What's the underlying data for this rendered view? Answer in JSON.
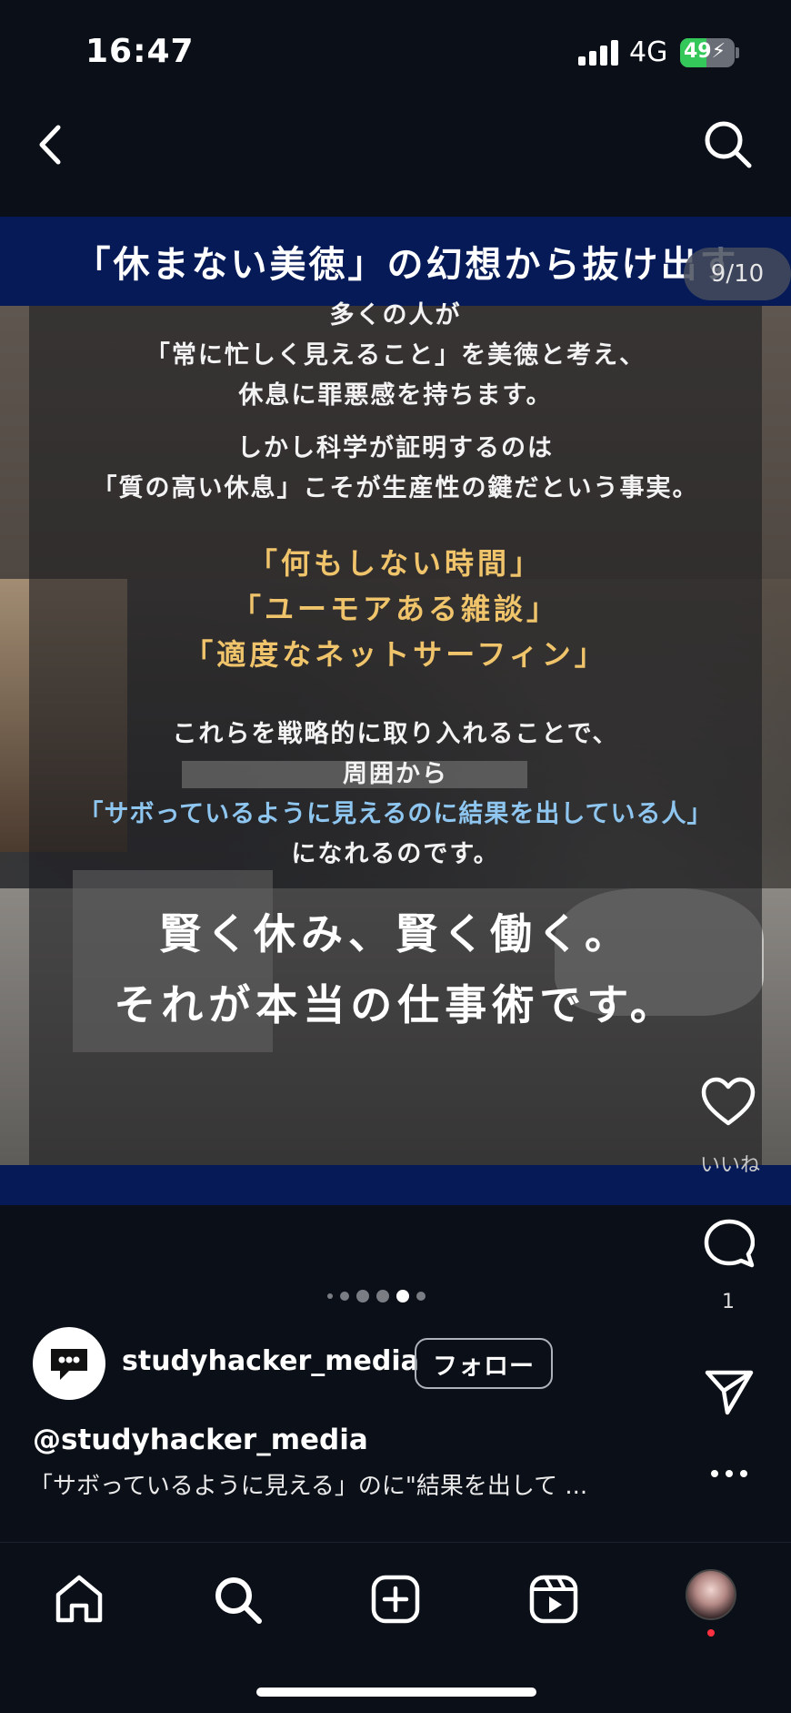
{
  "status_bar": {
    "time": "16:47",
    "network": "4G",
    "battery_text": "49",
    "battery_level": 0.49,
    "icons": [
      "signal-icon",
      "battery-icon",
      "charging-icon"
    ]
  },
  "nav": {
    "back_icon": "chevron-left-icon",
    "search_icon": "search-icon"
  },
  "post": {
    "header_text": "「休まない美徳」の幻想から抜け出す",
    "counter": "9/10",
    "paragraph1": [
      "多くの人が",
      "「常に忙しく見えること」を美徳と考え、",
      "休息に罪悪感を持ちます。"
    ],
    "paragraph2": [
      "しかし科学が証明するのは",
      "「質の高い休息」こそが生産性の鍵だという事実。"
    ],
    "highlights": [
      "「何もしない時間」",
      "「ユーモアある雑談」",
      "「適度なネットサーフィン」"
    ],
    "paragraph3": [
      "これらを戦略的に取り入れることで、",
      "周囲から"
    ],
    "blue_line": "「サボっているように見えるのに結果を出している人」",
    "paragraph3_end": "になれるのです。",
    "closing": [
      "賢く休み、賢く働く。",
      "それが本当の仕事術です。"
    ],
    "colors": {
      "header_bg": "#051a57",
      "gold": "#f0c46b",
      "blue": "#8ec6f0"
    }
  },
  "actions": {
    "like_label": "いいね",
    "comment_count": "1",
    "icons": [
      "heart-icon",
      "comment-icon",
      "share-icon",
      "more-icon"
    ]
  },
  "carousel": {
    "count": 5,
    "active_index": 3
  },
  "account": {
    "username": "studyhacker_media",
    "follow_label": "フォロー",
    "handle": "@studyhacker_media",
    "caption": "「サボっているように見える」のに\"結果を出して ..."
  },
  "tabbar": {
    "icons": [
      "home-icon",
      "search-icon",
      "create-icon",
      "reels-icon",
      "profile-avatar"
    ]
  }
}
